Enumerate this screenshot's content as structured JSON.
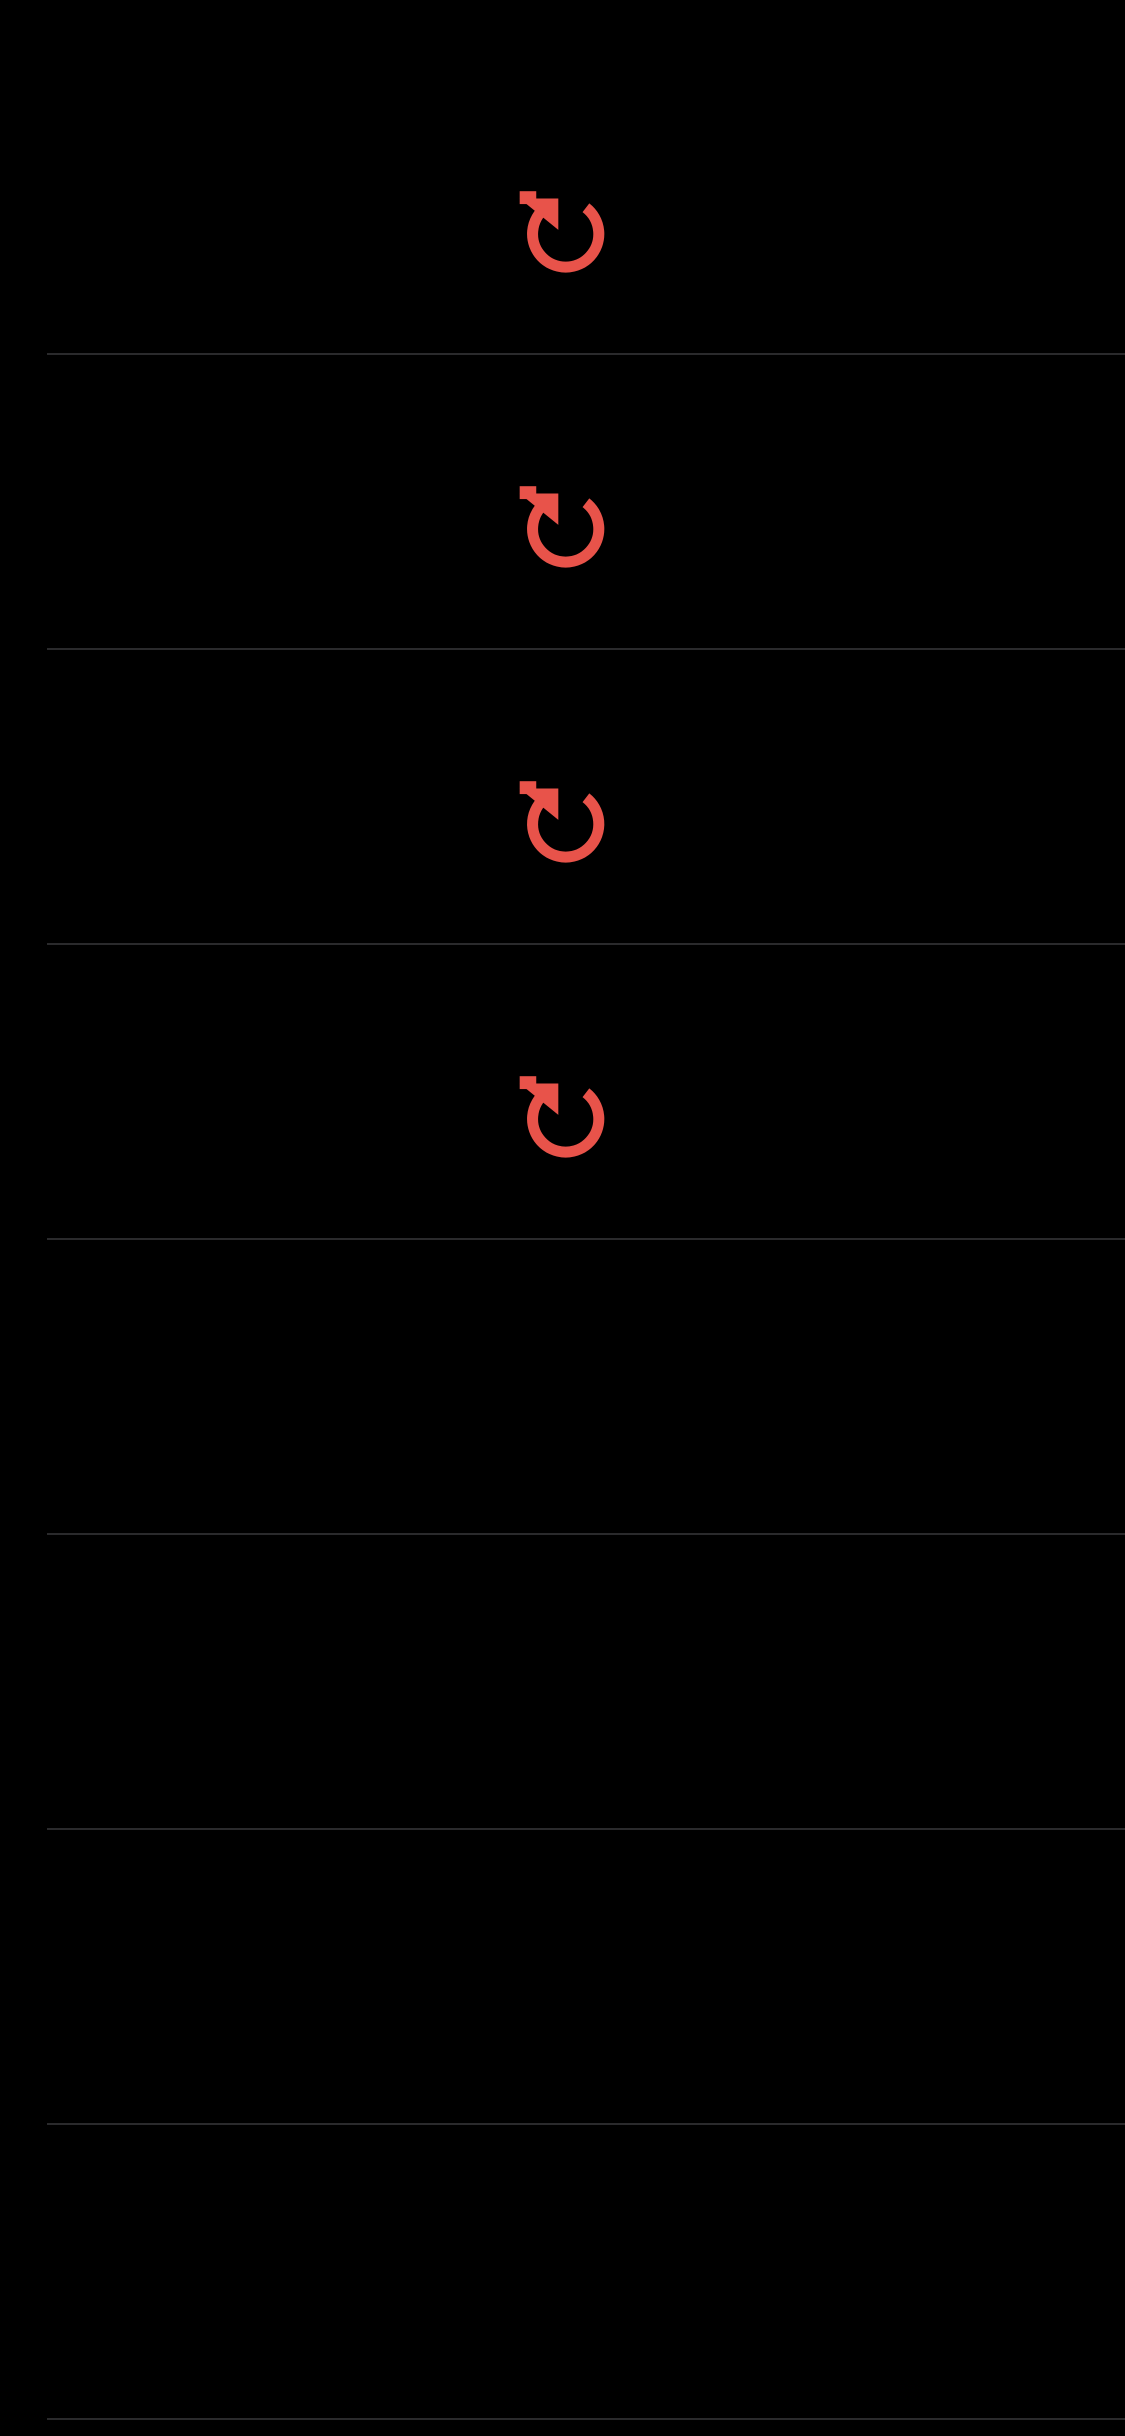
{
  "screen": {
    "background": "#000000",
    "divider_color": "#2a2a2c",
    "accent_color": "#E8534A"
  },
  "rows": [
    {
      "icon": "retry-icon",
      "has_action": true
    },
    {
      "icon": "retry-icon",
      "has_action": true
    },
    {
      "icon": "retry-icon",
      "has_action": true
    },
    {
      "icon": "retry-icon",
      "has_action": true
    },
    {
      "icon": "",
      "has_action": false
    },
    {
      "icon": "",
      "has_action": false
    },
    {
      "icon": "",
      "has_action": false
    },
    {
      "icon": "",
      "has_action": false
    }
  ]
}
